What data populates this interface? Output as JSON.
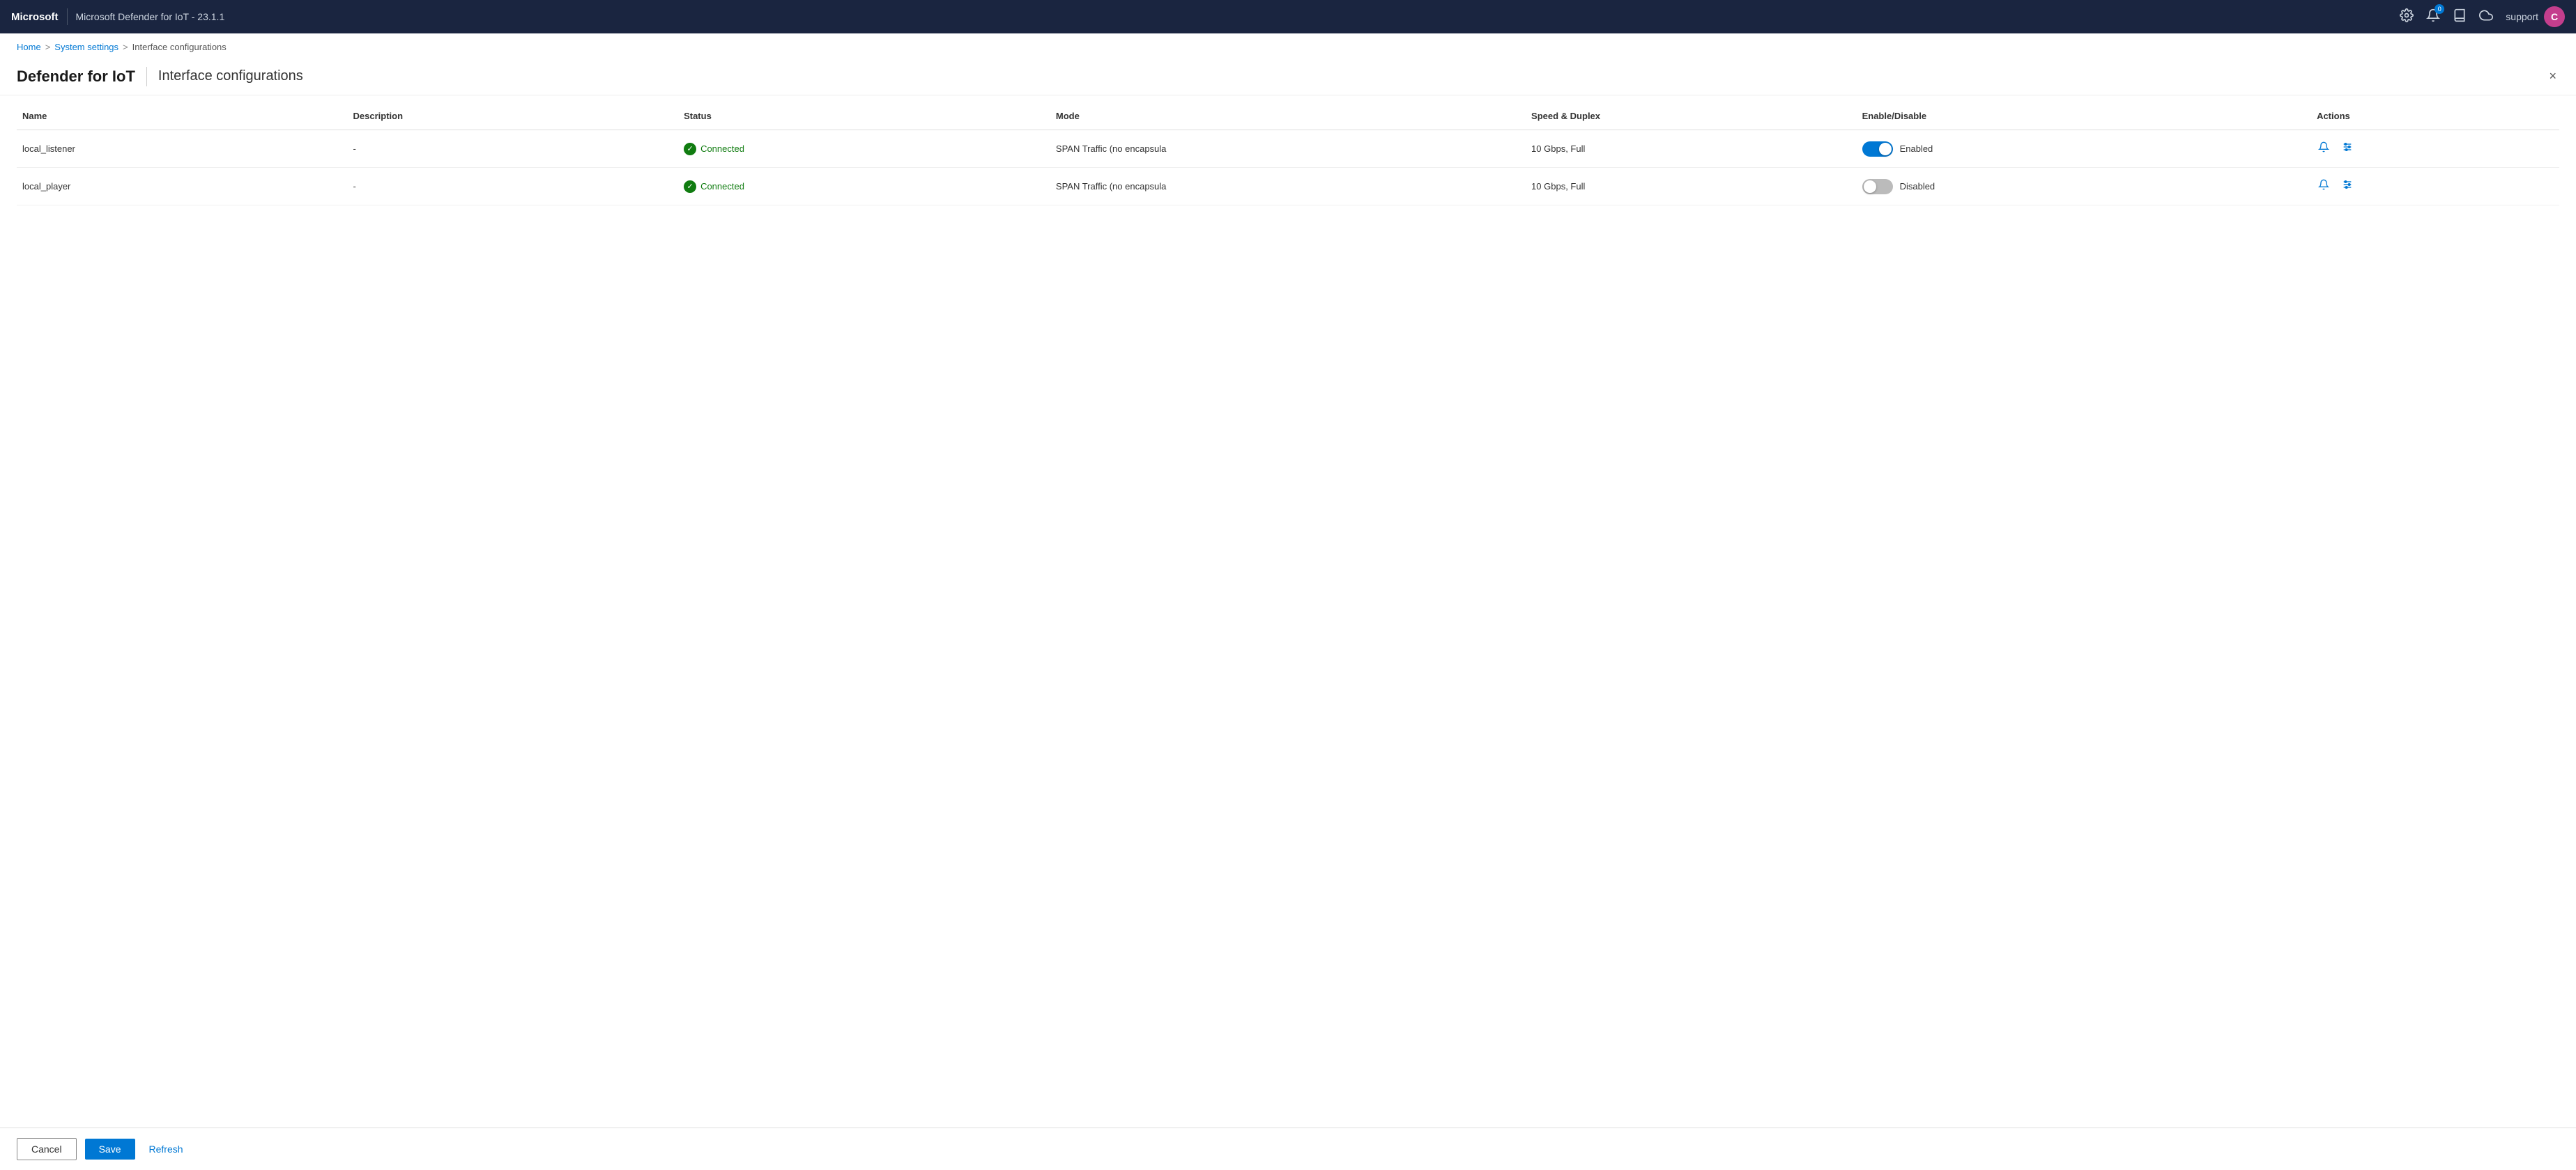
{
  "app": {
    "brand": "Microsoft",
    "title": "Microsoft Defender for IoT - 23.1.1"
  },
  "nav": {
    "settings_icon": "⚙",
    "notification_icon": "🔔",
    "notification_count": "0",
    "book_icon": "📖",
    "cloud_icon": "☁",
    "user_name": "support",
    "user_initial": "C",
    "user_avatar_color": "#c43e8d"
  },
  "breadcrumb": {
    "home": "Home",
    "system_settings": "System settings",
    "current": "Interface configurations"
  },
  "page": {
    "title": "Defender for IoT",
    "subtitle": "Interface configurations",
    "close_label": "×"
  },
  "table": {
    "columns": {
      "name": "Name",
      "description": "Description",
      "status": "Status",
      "mode": "Mode",
      "speed_duplex": "Speed & Duplex",
      "enable_disable": "Enable/Disable",
      "actions": "Actions"
    },
    "rows": [
      {
        "name": "local_listener",
        "description": "-",
        "status": "Connected",
        "mode": "SPAN Traffic (no encapsula",
        "speed_duplex": "10 Gbps, Full",
        "enabled": true,
        "toggle_label_on": "Enabled",
        "toggle_label_off": "Disabled"
      },
      {
        "name": "local_player",
        "description": "-",
        "status": "Connected",
        "mode": "SPAN Traffic (no encapsula",
        "speed_duplex": "10 Gbps, Full",
        "enabled": false,
        "toggle_label_on": "Enabled",
        "toggle_label_off": "Disabled"
      }
    ]
  },
  "footer": {
    "cancel_label": "Cancel",
    "save_label": "Save",
    "refresh_label": "Refresh"
  }
}
